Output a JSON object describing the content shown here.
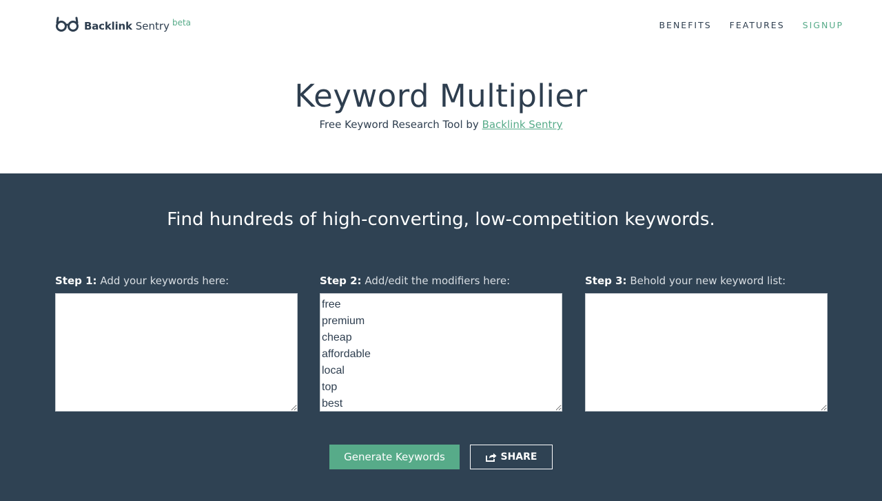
{
  "brand": {
    "name_bold": "Backlink",
    "name_light": "Sentry",
    "badge": "beta",
    "accent_color": "#57ab89",
    "icon": "glasses-icon"
  },
  "nav": {
    "items": [
      {
        "label": "BENEFITS"
      },
      {
        "label": "FEATURES"
      },
      {
        "label": "SIGNUP"
      }
    ]
  },
  "hero": {
    "title": "Keyword Multiplier",
    "subtitle_prefix": "Free Keyword Research Tool by ",
    "subtitle_link": "Backlink Sentry"
  },
  "main": {
    "background_color": "#2f4253",
    "tagline": "Find hundreds of high-converting, low-competition keywords.",
    "steps": [
      {
        "label_bold": "Step 1:",
        "label_text": " Add your keywords here:",
        "value": ""
      },
      {
        "label_bold": "Step 2:",
        "label_text": " Add/edit the modifiers here:",
        "value": "free\npremium\ncheap\naffordable\nlocal\ntop\nbest"
      },
      {
        "label_bold": "Step 3:",
        "label_text": " Behold your new keyword list:",
        "value": ""
      }
    ],
    "generate_label": "Generate Keywords",
    "share_label": "SHARE",
    "share_icon": "share-icon"
  }
}
